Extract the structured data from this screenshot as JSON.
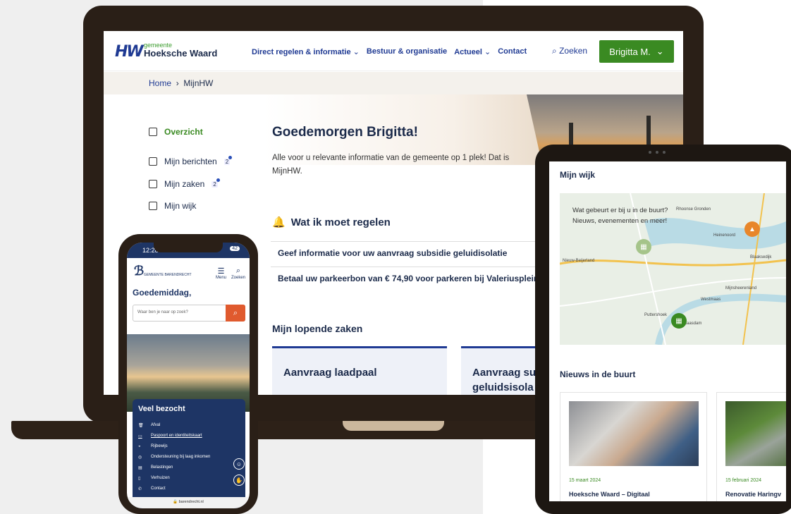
{
  "desktop": {
    "logo": {
      "small": "gemeente",
      "name": "Hoeksche Waard",
      "mark": "HW"
    },
    "nav": [
      {
        "label": "Direct regelen & informatie",
        "chevron": "⌄"
      },
      {
        "label": "Bestuur & organisatie",
        "chevron": ""
      },
      {
        "label": "Actueel",
        "chevron": "⌄"
      },
      {
        "label": "Contact",
        "chevron": ""
      }
    ],
    "search_label": "Zoeken",
    "user_button": "Brigitta M.",
    "breadcrumb": {
      "home": "Home",
      "sep": "›",
      "current": "MijnHW"
    },
    "sidebar": [
      {
        "label": "Overzicht",
        "badge": ""
      },
      {
        "label": "Mijn berichten",
        "badge": "2"
      },
      {
        "label": "Mijn zaken",
        "badge": "2"
      },
      {
        "label": "Mijn wijk",
        "badge": ""
      }
    ],
    "greeting": "Goedemorgen Brigitta!",
    "intro": "Alle voor u relevante informatie van de gemeente op 1 plek! Dat is MijnHW.",
    "todo_heading": "Wat ik moet regelen",
    "todos": [
      "Geef informatie voor uw aanvraag subsidie geluidisolatie",
      "Betaal uw parkeerbon van € 74,90 voor parkeren bij Valeriusplein"
    ],
    "cases_heading": "Mijn lopende zaken",
    "cases": [
      "Aanvraag laadpaal",
      "Aanvraag su geluidsisola"
    ]
  },
  "phone": {
    "time": "12:28",
    "battery": "42",
    "logo_text": "GEMEENTE BARENDRECHT",
    "menu_label": "Menu",
    "search_label": "Zoeken",
    "greeting": "Goedemiddag,",
    "search_placeholder": "Waar ben je naar op zoek?",
    "popular_heading": "Veel bezocht",
    "popular": [
      "Afval",
      "Paspoort en identiteitskaart",
      "Rijbewijs",
      "Ondersteuning bij laag inkomen",
      "Belastingen",
      "Verhuizen",
      "Contact"
    ],
    "url": "barendrecht.nl"
  },
  "tablet": {
    "heading": "Mijn wijk",
    "map_question": "Wat gebeurt er bij u in de buurt? Nieuws, evenementen en meer!",
    "map_labels": [
      "Rhoonse Gronden",
      "Heinenoord",
      "Blaaksedijk",
      "Nieuw-Beijerland",
      "Mijnsheerenland",
      "Westmaas",
      "Puttershoek",
      "Maasdam"
    ],
    "news_heading": "Nieuws in de buurt",
    "news": [
      {
        "date": "15 maart 2024",
        "title": "Hoeksche Waard – Digitaal"
      },
      {
        "date": "15 februari 2024",
        "title": "Renovatie Haringv"
      }
    ]
  },
  "colors": {
    "brand_green": "#3a8a22",
    "brand_blue": "#1f3a93",
    "phone_navy": "#1e3565",
    "accent_orange": "#e05a2e"
  }
}
